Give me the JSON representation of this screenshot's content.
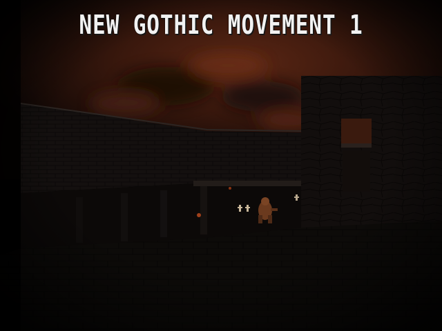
{
  "title": {
    "text": "NEW GOTHIC MOVEMENT 1"
  },
  "colors": {
    "sky": "#2a120a",
    "sky_glow": "#5a2614",
    "wall": "#1e1917",
    "floor": "#1a1614",
    "title_text": "#f2f2f2"
  }
}
